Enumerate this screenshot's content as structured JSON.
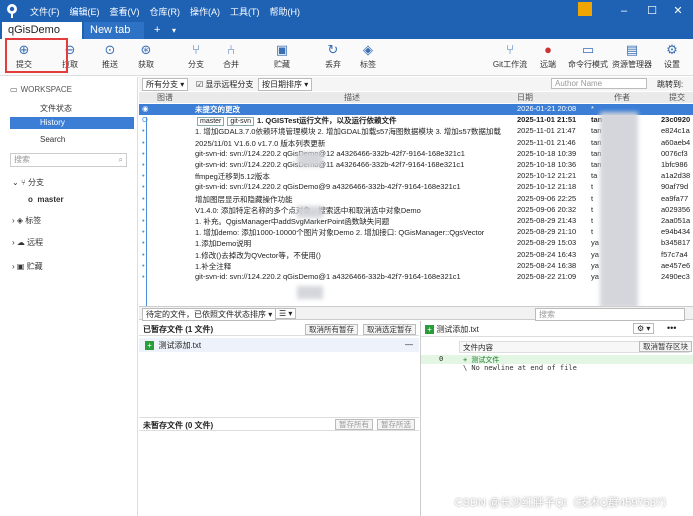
{
  "menu": [
    "文件(F)",
    "编辑(E)",
    "查看(V)",
    "仓库(R)",
    "操作(A)",
    "工具(T)",
    "帮助(H)"
  ],
  "tabs": {
    "active": "qGisDemo",
    "inactive": "New tab"
  },
  "toolbar": {
    "commit": "提交",
    "pull": "拉取",
    "push": "推送",
    "fetch": "获取",
    "branch": "分支",
    "merge": "合并",
    "stash": "贮藏",
    "discard": "丢弃",
    "tag": "标签",
    "gitflow": "Git工作流",
    "remote": "远端",
    "terminal": "命令行模式",
    "explorer": "资源管理器",
    "settings": "设置"
  },
  "sidebar": {
    "workspace": "WORKSPACE",
    "file_status": "文件状态",
    "history": "History",
    "search": "Search",
    "search_placeholder": "搜索",
    "branches": "分支",
    "master": "master",
    "tags": "标签",
    "remotes": "远程",
    "stashes": "贮藏"
  },
  "filter": {
    "all_branches": "所有分支",
    "show_remote": "显示远程分支",
    "sort": "按日期排序",
    "author_placeholder": "Author Name",
    "jump": "跳转到:"
  },
  "columns": {
    "graph": "图谱",
    "desc": "描述",
    "date": "日期",
    "author": "作者",
    "commit": "提交"
  },
  "rows": [
    {
      "d": "未提交的更改",
      "t": "2026-01-21 20:08",
      "a": "*",
      "h": ""
    },
    {
      "d": "1. QGISTest运行文件，以及运行依赖文件",
      "tags": [
        "master",
        "git-svn"
      ],
      "t": "2025-11-01 21:51",
      "a": "tan",
      "h": "23c0920"
    },
    {
      "d": "1. 增加GDAL3.7.0依赖环境管理模块 2. 增加GDAL加载s57海图数据模块 3. 增加s57数据加载",
      "t": "2025-11-01 21:47",
      "a": "tan",
      "h": "e824c1a"
    },
    {
      "d": "2025/11/01 V1.6.0 v1.7.0 版本列表更新",
      "t": "2025-11-01 21:46",
      "a": "tan",
      "h": "a60aeb4"
    },
    {
      "d": "git-svn-id: svn://124.220.2  qGisDemo@12 a4326466-332b-42f7-9164-168e321c1",
      "t": "2025-10-18 10:39",
      "a": "tan",
      "h": "0076cf3"
    },
    {
      "d": "git-svn-id: svn://124.220.2  qGisDemo@11 a4326466-332b-42f7-9164-168e321c1",
      "t": "2025-10-18 10:36",
      "a": "tan",
      "h": "1bfc986"
    },
    {
      "d": "ffmpeg迁移到5.12版本",
      "t": "2025-10-12 21:21",
      "a": "ta",
      "h": "a1a2d38"
    },
    {
      "d": "git-svn-id: svn://124.220.2  qGisDemo@9 a4326466-332b-42f7-9164-168e321c1",
      "t": "2025-10-12 21:18",
      "a": "t",
      "h": "90af79d"
    },
    {
      "d": "增加图层显示和隐藏操作功能",
      "t": "2025-09-06 22:25",
      "a": "t",
      "h": "ea9fa77"
    },
    {
      "d": "V1.4.0: 添加特定名称的多个点对象，搜索选中和取消选中对象Demo",
      "t": "2025-09-06 20:32",
      "a": "t",
      "h": "a029356"
    },
    {
      "d": "1. 补充。QgisManager中addSvgMarkerPoint函数缺失问题",
      "t": "2025-08-29 21:43",
      "a": "t",
      "h": "2aa051a"
    },
    {
      "d": "1. 增加demo: 添加1000-10000个图片对象Demo 2. 增加接口: QGisManager::QgsVector",
      "t": "2025-08-29 21:10",
      "a": "t",
      "h": "e94b434"
    },
    {
      "d": "1.添加Demo说明",
      "t": "2025-08-29 15:03",
      "a": "ya",
      "h": "b345817"
    },
    {
      "d": "1.修改()去掉改为QVector等，不使用()",
      "t": "2025-08-24 16:43",
      "a": "ya",
      "h": "f57c7a4"
    },
    {
      "d": "1.补全注释",
      "t": "2025-08-24 16:38",
      "a": "ya",
      "h": "ae457e6"
    },
    {
      "d": "git-svn-id: svn://124.220.2  qGisDemo@1 a4326466-332b-42f7-9164-168e321c1",
      "t": "2025-08-22 21:09",
      "a": "ya",
      "h": "2490ec3"
    }
  ],
  "midbar": {
    "pending": "待定的文件，已依照文件状态排序",
    "search": "搜索"
  },
  "staged": {
    "title": "已暂存文件 (1 文件)",
    "unstage_all": "取消所有暂存",
    "unstage_sel": "取消选定暂存",
    "file": "测试添加.txt"
  },
  "unstaged": {
    "title": "未暂存文件 (0 文件)",
    "stage_all": "暂存所有",
    "stage_sel": "暂存所选"
  },
  "diff": {
    "file": "测试添加.txt",
    "content_label": "文件内容",
    "unstage_block": "取消暂存区块",
    "line_no": "0",
    "added": "+ 测试文件",
    "nonewline": "\\ No newline at end of file"
  },
  "watermark": "CSDN @长沙红胖子Qt（技术Q群4597637）"
}
